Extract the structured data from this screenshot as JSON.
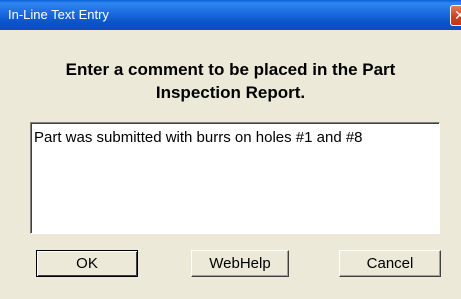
{
  "window": {
    "title": "In-Line Text Entry",
    "close_icon": "close-icon"
  },
  "prompt": {
    "line1": "Enter a comment to be placed in the Part",
    "line2": "Inspection Report."
  },
  "comment": {
    "value": "Part was submitted with burrs on holes #1 and #8"
  },
  "buttons": {
    "ok_label": "OK",
    "help_label": "WebHelp",
    "cancel_label": "Cancel"
  },
  "colors": {
    "titlebar": "#0a53c8",
    "dialog_face": "#ece9d8",
    "close_button": "#d2411c"
  }
}
